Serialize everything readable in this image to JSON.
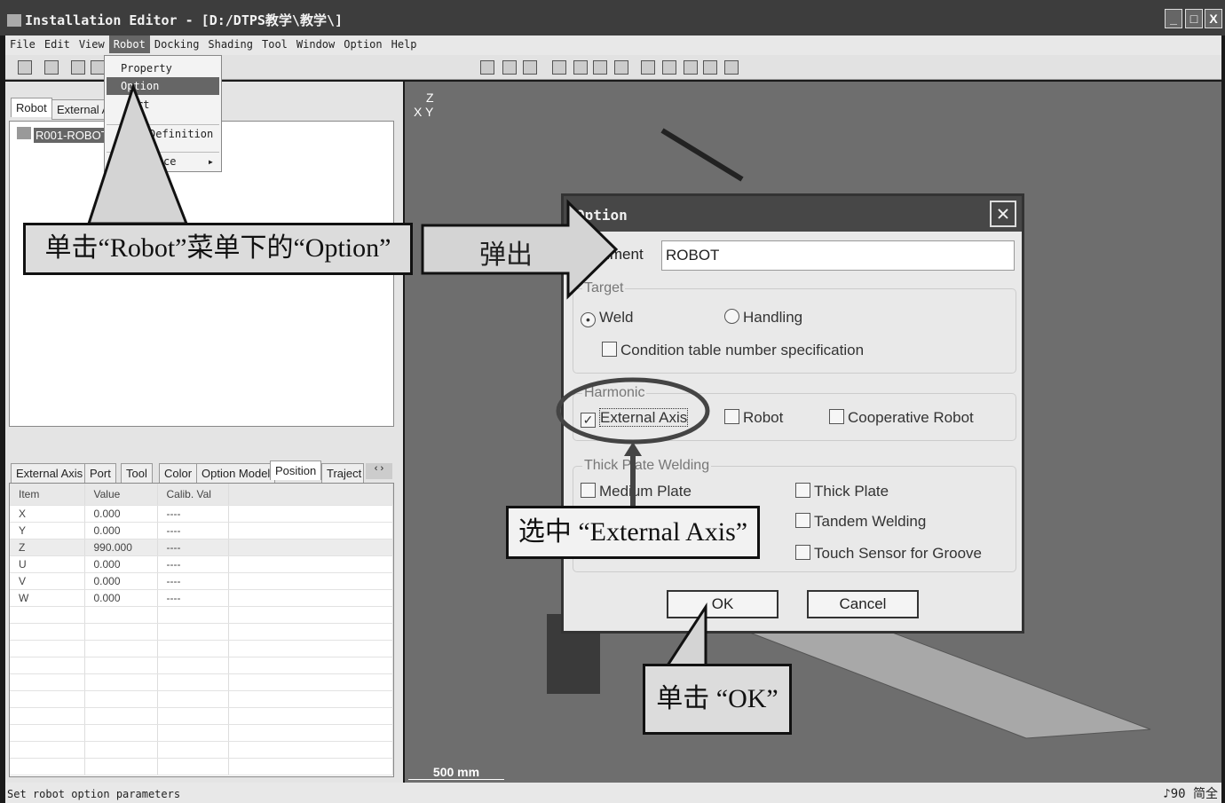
{
  "window": {
    "title": "Installation Editor - [D:/DTPS教学\\教学\\]",
    "minimize": "_",
    "maximize": "□",
    "close": "X"
  },
  "menubar": [
    "File",
    "Edit",
    "View",
    "Robot",
    "Docking",
    "Shading",
    "Tool",
    "Window",
    "Option",
    "Help"
  ],
  "robot_menu": {
    "items": [
      "Property",
      "Option",
      "rt",
      "Definition",
      "ce"
    ]
  },
  "left_panel": {
    "top_tabs": [
      "Robot",
      "External A"
    ],
    "tree_item": "R001-ROBOT",
    "bottom_tabs": [
      "External Axis",
      "Port",
      "Tool",
      "Color",
      "Option Model",
      "Position",
      "Traject"
    ],
    "active_tab": "Position",
    "columns": [
      "Item",
      "Value",
      "Calib. Val"
    ],
    "rows": [
      [
        "X",
        "0.000",
        "----"
      ],
      [
        "Y",
        "0.000",
        "----"
      ],
      [
        "Z",
        "990.000",
        "----"
      ],
      [
        "U",
        "0.000",
        "----"
      ],
      [
        "V",
        "0.000",
        "----"
      ],
      [
        "W",
        "0.000",
        "----"
      ]
    ]
  },
  "viewport": {
    "scale": "500 mm",
    "axes": [
      "Z",
      "X",
      "Y"
    ]
  },
  "status": {
    "text": "Set robot option parameters",
    "ime": "♪90 简全"
  },
  "dialog": {
    "title": "Option",
    "comment_label": "Comment",
    "comment_value": "ROBOT",
    "target": {
      "label": "Target",
      "weld": "Weld",
      "handling": "Handling",
      "selected": "Weld",
      "condition": "Condition table number specification"
    },
    "harmonic": {
      "label": "Harmonic",
      "external_axis": "External Axis",
      "external_axis_checked": true,
      "robot": "Robot",
      "cooperative": "Cooperative Robot"
    },
    "thick": {
      "label": "Thick Plate Welding",
      "medium": "Medium Plate",
      "thick": "Thick Plate",
      "tandem": "Tandem Welding",
      "touch": "Touch Sensor for Groove"
    },
    "ok": "OK",
    "cancel": "Cancel"
  },
  "annotations": {
    "click_option": "单击“Robot”菜单下的“Option”",
    "popup": "弹出",
    "select_ext": "选中 “External Axis”",
    "click_ok": "单击 “OK”"
  }
}
